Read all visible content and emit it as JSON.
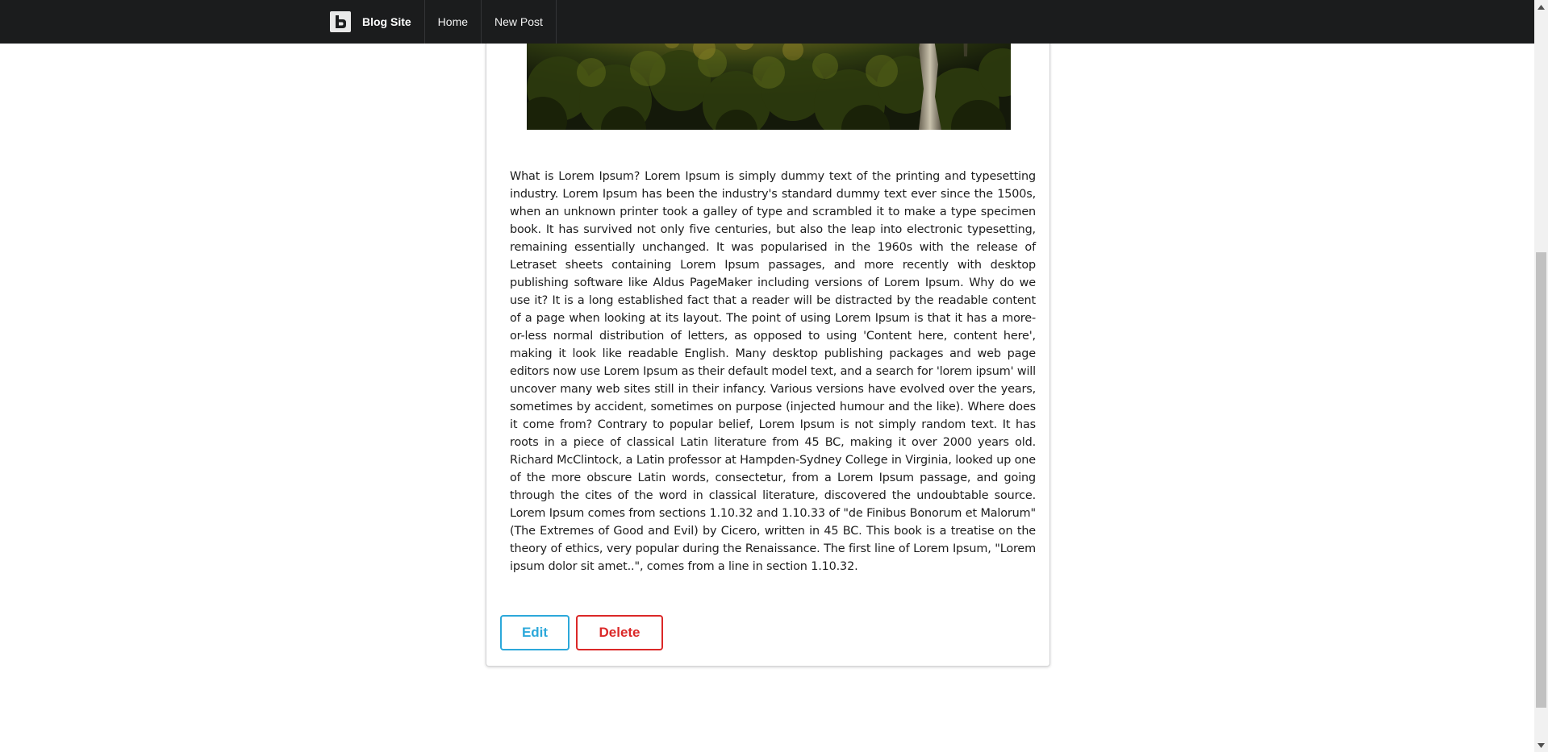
{
  "navbar": {
    "brand": "Blog Site",
    "items": [
      "Home",
      "New Post"
    ]
  },
  "post": {
    "body": "What is Lorem Ipsum? Lorem Ipsum is simply dummy text of the printing and typesetting industry. Lorem Ipsum has been the industry's standard dummy text ever since the 1500s, when an unknown printer took a galley of type and scrambled it to make a type specimen book. It has survived not only five centuries, but also the leap into electronic typesetting, remaining essentially unchanged. It was popularised in the 1960s with the release of Letraset sheets containing Lorem Ipsum passages, and more recently with desktop publishing software like Aldus PageMaker including versions of Lorem Ipsum. Why do we use it? It is a long established fact that a reader will be distracted by the readable content of a page when looking at its layout. The point of using Lorem Ipsum is that it has a more-or-less normal distribution of letters, as opposed to using 'Content here, content here', making it look like readable English. Many desktop publishing packages and web page editors now use Lorem Ipsum as their default model text, and a search for 'lorem ipsum' will uncover many web sites still in their infancy. Various versions have evolved over the years, sometimes by accident, sometimes on purpose (injected humour and the like). Where does it come from? Contrary to popular belief, Lorem Ipsum is not simply random text. It has roots in a piece of classical Latin literature from 45 BC, making it over 2000 years old. Richard McClintock, a Latin professor at Hampden-Sydney College in Virginia, looked up one of the more obscure Latin words, consectetur, from a Lorem Ipsum passage, and going through the cites of the word in classical literature, discovered the undoubtable source. Lorem Ipsum comes from sections 1.10.32 and 1.10.33 of \"de Finibus Bonorum et Malorum\" (The Extremes of Good and Evil) by Cicero, written in 45 BC. This book is a treatise on the theory of ethics, very popular during the Renaissance. The first line of Lorem Ipsum, \"Lorem ipsum dolor sit amet..\", comes from a line in section 1.10.32.",
    "edit_label": "Edit",
    "delete_label": "Delete"
  },
  "colors": {
    "navbar_bg": "#1b1c1d",
    "edit": "#2ca8da",
    "delete": "#db2828"
  },
  "icons": {
    "brand": "blog-logo-icon",
    "scroll_up": "scroll-up-arrow-icon",
    "scroll_down": "scroll-down-arrow-icon"
  }
}
